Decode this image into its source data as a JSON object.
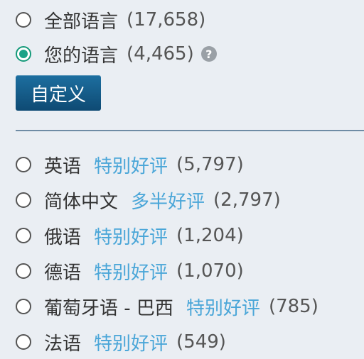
{
  "filter_top": {
    "all_languages": {
      "label": "全部语言",
      "count": "(17,658)",
      "selected": false
    },
    "your_languages": {
      "label": "您的语言",
      "count": "(4,465)",
      "selected": true,
      "help_glyph": "?"
    },
    "customize_label": "自定义"
  },
  "languages": [
    {
      "name": "英语",
      "rating": "特别好评",
      "count": "(5,797)"
    },
    {
      "name": "简体中文",
      "rating": "多半好评",
      "count": "(2,797)"
    },
    {
      "name": "俄语",
      "rating": "特别好评",
      "count": "(1,204)"
    },
    {
      "name": "德语",
      "rating": "特别好评",
      "count": "(1,070)"
    },
    {
      "name": "葡萄牙语 - 巴西",
      "rating": "特别好评",
      "count": "(785)"
    },
    {
      "name": "法语",
      "rating": "特别好评",
      "count": "(549)"
    }
  ],
  "colors": {
    "background": "#eaeef3",
    "rating_text": "#4aa6d8",
    "radio_checked": "#1aa387",
    "button_bg": "#0e4a73",
    "divider": "#6f8ca5"
  }
}
